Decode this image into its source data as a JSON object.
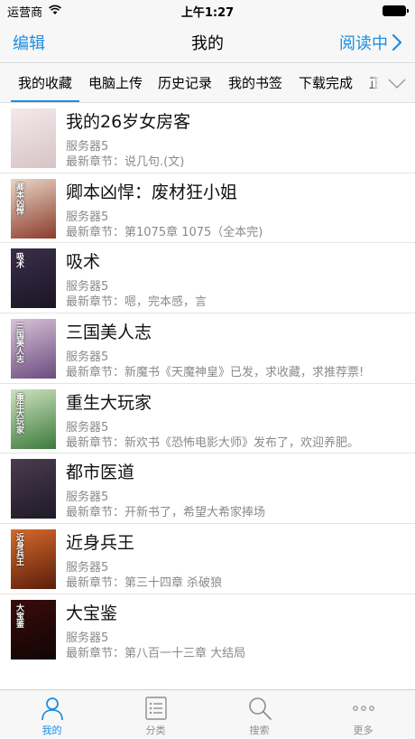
{
  "status_bar": {
    "carrier": "运营商",
    "time": "上午1:27"
  },
  "nav": {
    "left_label": "编辑",
    "title": "我的",
    "right_label": "阅读中"
  },
  "tabs": [
    {
      "label": "我的收藏",
      "active": true
    },
    {
      "label": "电脑上传",
      "active": false
    },
    {
      "label": "历史记录",
      "active": false
    },
    {
      "label": "我的书签",
      "active": false
    },
    {
      "label": "下载完成",
      "active": false
    },
    {
      "label": "正",
      "active": false
    }
  ],
  "books": [
    {
      "title": "我的26岁女房客",
      "source": "服务器5",
      "latest": "最新章节：说几句.(文)"
    },
    {
      "title": "卿本凶悍：废材狂小姐",
      "source": "服务器5",
      "latest": "最新章节：第1075章 1075（全本完)"
    },
    {
      "title": "吸术",
      "source": "服务器5",
      "latest": "最新章节：嗯，完本感，言"
    },
    {
      "title": "三国美人志",
      "source": "服务器5",
      "latest": "最新章节：新魔书《天魔神皇》已发，求收藏，求推荐票!"
    },
    {
      "title": "重生大玩家",
      "source": "服务器5",
      "latest": "最新章节：新欢书《恐怖电影大师》发布了，欢迎养肥。"
    },
    {
      "title": "都市医道",
      "source": "服务器5",
      "latest": "最新章节：开新书了，希望大希家捧场"
    },
    {
      "title": "近身兵王",
      "source": "服务器5",
      "latest": "最新章节：第三十四章 杀破狼"
    },
    {
      "title": "大宝鉴",
      "source": "服务器5",
      "latest": "最新章节：第八百一十三章 大结局"
    }
  ],
  "covers": [
    {
      "text": "",
      "c1": "#f3e9ea",
      "c2": "#d7c3c6"
    },
    {
      "text": "卿本凶悍",
      "c1": "#e9d7c6",
      "c2": "#8c3a2c"
    },
    {
      "text": "吸术",
      "c1": "#3a2f4a",
      "c2": "#1a1524"
    },
    {
      "text": "三国美人志",
      "c1": "#d8c3d8",
      "c2": "#6b4b7e"
    },
    {
      "text": "重生大玩家",
      "c1": "#cfe2c1",
      "c2": "#3c7a3a"
    },
    {
      "text": "",
      "c1": "#4b3b4f",
      "c2": "#1e1a26"
    },
    {
      "text": "近身兵王",
      "c1": "#d66b2b",
      "c2": "#5a1d0c"
    },
    {
      "text": "大宝鉴",
      "c1": "#3a0c0c",
      "c2": "#120404"
    }
  ],
  "tabbar": [
    {
      "label": "我的",
      "icon": "person-icon",
      "active": true
    },
    {
      "label": "分类",
      "icon": "list-icon",
      "active": false
    },
    {
      "label": "搜索",
      "icon": "search-icon",
      "active": false
    },
    {
      "label": "更多",
      "icon": "more-icon",
      "active": false
    }
  ],
  "colors": {
    "accent": "#1a8ee3",
    "secondary_text": "#8a8a8a"
  }
}
